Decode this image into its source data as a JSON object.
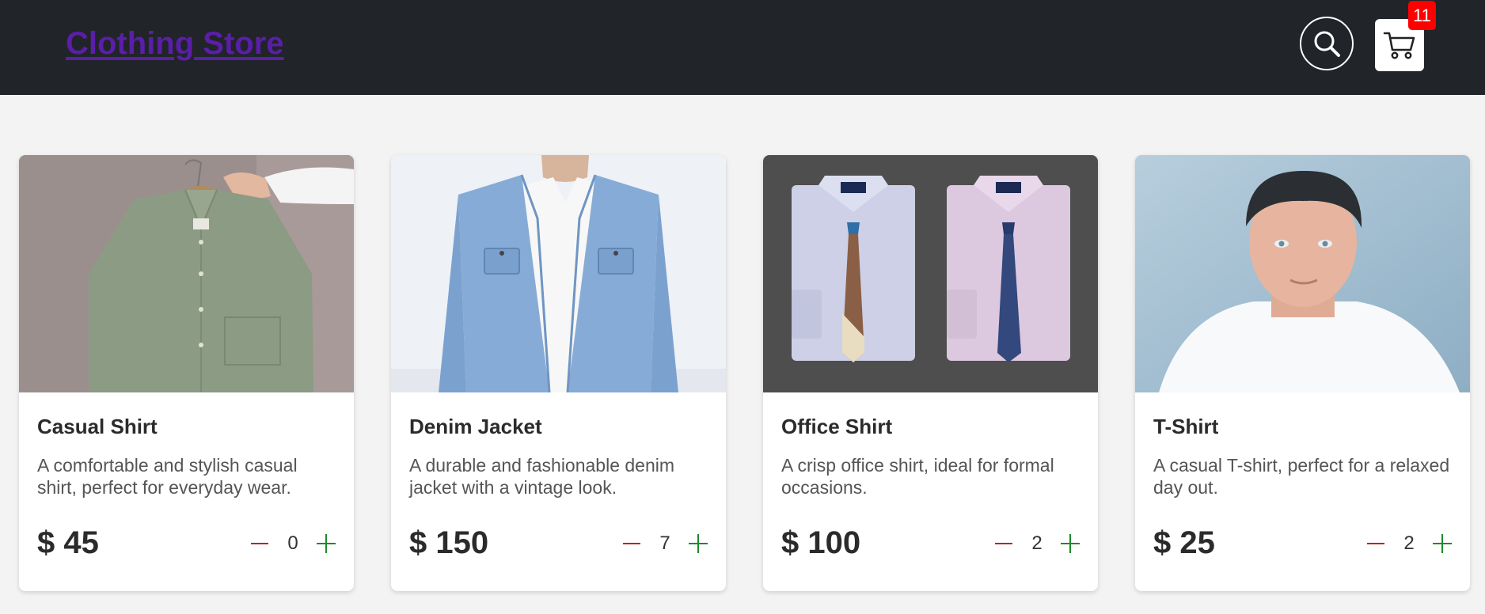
{
  "header": {
    "brand": "Clothing Store",
    "cart_count": "11"
  },
  "products": [
    {
      "title": "Casual Shirt",
      "description": "A comfortable and stylish casual shirt, perfect for everyday wear.",
      "price": "$ 45",
      "quantity": "0"
    },
    {
      "title": "Denim Jacket",
      "description": "A durable and fashionable denim jacket with a vintage look.",
      "price": "$ 150",
      "quantity": "7"
    },
    {
      "title": "Office Shirt",
      "description": "A crisp office shirt, ideal for formal occasions.",
      "price": "$ 100",
      "quantity": "2"
    },
    {
      "title": "T-Shirt",
      "description": "A casual T-shirt, perfect for a relaxed day out.",
      "price": "$ 25",
      "quantity": "2"
    }
  ],
  "colors": {
    "header_bg": "#212429",
    "brand": "#5b1ea8",
    "badge": "#ff0000",
    "minus": "#c71c1c",
    "plus": "#1e8a2a"
  }
}
